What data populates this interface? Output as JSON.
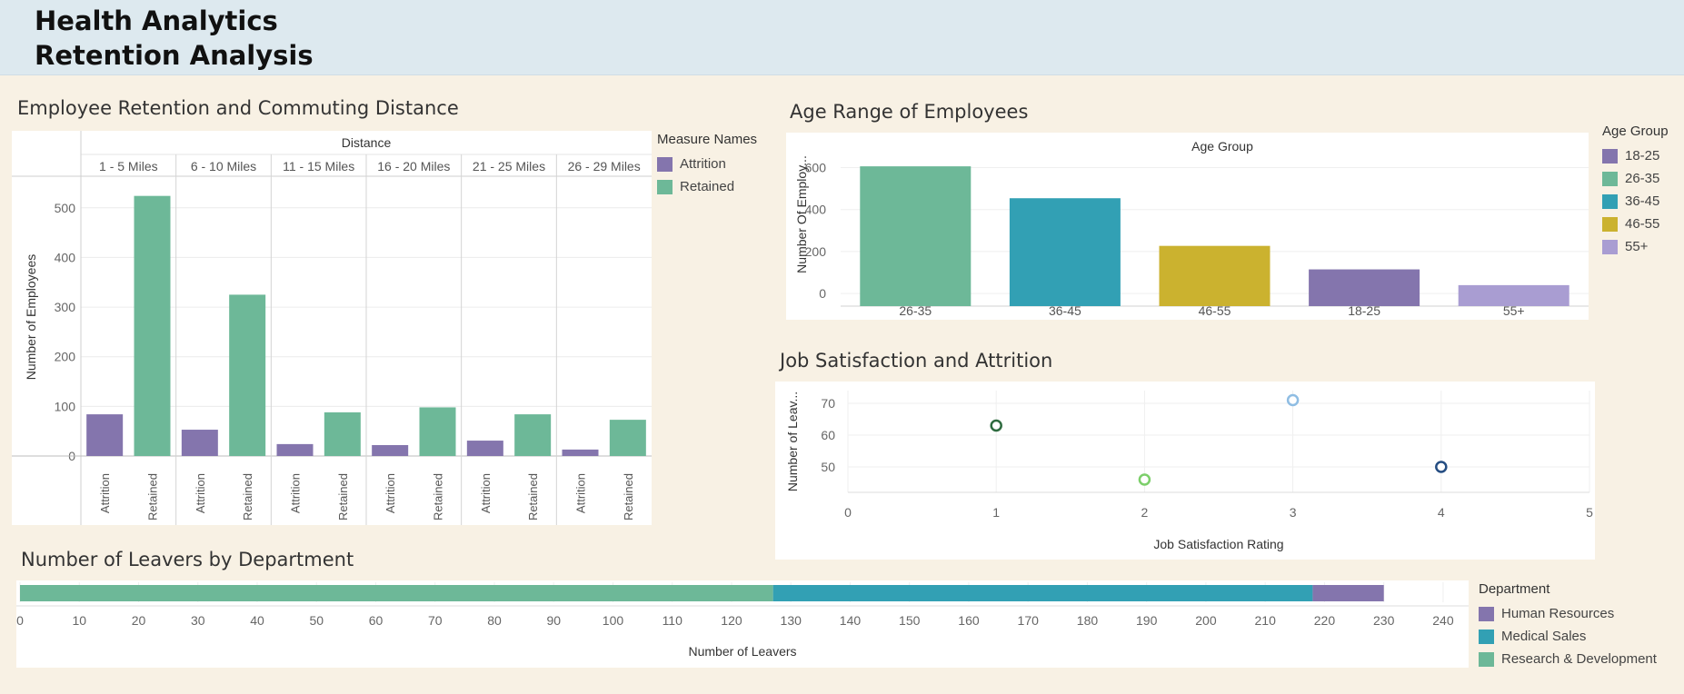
{
  "header": {
    "title_line1": "Health Analytics",
    "title_line2": "Retention Analysis"
  },
  "commute": {
    "title": "Employee Retention and Commuting Distance",
    "legend_title": "Measure Names",
    "legend": [
      {
        "label": "Attrition",
        "color": "#8475ad"
      },
      {
        "label": "Retained",
        "color": "#6db898"
      }
    ]
  },
  "age": {
    "title": "Age Range of Employees",
    "legend_title": "Age Group",
    "legend": [
      {
        "label": "18-25",
        "color": "#8475ad"
      },
      {
        "label": "26-35",
        "color": "#6db898"
      },
      {
        "label": "36-45",
        "color": "#32a0b4"
      },
      {
        "label": "46-55",
        "color": "#cbb22f"
      },
      {
        "label": "55+",
        "color": "#a99dd2"
      }
    ]
  },
  "satisfaction": {
    "title": "Job Satisfaction and Attrition"
  },
  "leavers": {
    "title": "Number of Leavers by Department",
    "legend_title": "Department",
    "legend": [
      {
        "label": "Human Resources",
        "color": "#8475ad"
      },
      {
        "label": "Medical Sales",
        "color": "#32a0b4"
      },
      {
        "label": "Research & Development",
        "color": "#6db898"
      }
    ]
  },
  "chart_data": [
    {
      "type": "bar",
      "title": "Employee Retention and Commuting Distance",
      "header_label": "Distance",
      "ylabel": "Number of Employees",
      "categories": [
        "1 - 5 Miles",
        "6 - 10 Miles",
        "11 - 15 Miles",
        "16 - 20 Miles",
        "21 - 25 Miles",
        "26 - 29 Miles"
      ],
      "measures": [
        "Attrition",
        "Retained"
      ],
      "series": [
        {
          "name": "Attrition",
          "color": "#8475ad",
          "values": [
            84,
            53,
            24,
            22,
            31,
            13
          ]
        },
        {
          "name": "Retained",
          "color": "#6db898",
          "values": [
            524,
            325,
            88,
            98,
            84,
            73
          ]
        }
      ],
      "ylim": [
        0,
        560
      ],
      "yticks": [
        0,
        100,
        200,
        300,
        400,
        500
      ],
      "legend_position": "right",
      "grid": true
    },
    {
      "type": "bar",
      "title": "Age Range of Employees",
      "header_label": "Age Group",
      "ylabel": "Number Of Employ...",
      "categories": [
        "26-35",
        "36-45",
        "46-55",
        "18-25",
        "55+"
      ],
      "values": [
        606,
        454,
        227,
        115,
        40
      ],
      "colors": [
        "#6db898",
        "#32a0b4",
        "#cbb22f",
        "#8475ad",
        "#a99dd2"
      ],
      "ylim": [
        -60,
        680
      ],
      "yticks": [
        0,
        200,
        400,
        600
      ],
      "legend_position": "right",
      "grid": true
    },
    {
      "type": "scatter",
      "title": "Job Satisfaction and Attrition",
      "xlabel": "Job Satisfaction Rating",
      "ylabel": "Number of Leav...",
      "points": [
        {
          "x": 1,
          "y": 63,
          "color": "#2e6b3f"
        },
        {
          "x": 2,
          "y": 46,
          "color": "#7ccf6a"
        },
        {
          "x": 3,
          "y": 71,
          "color": "#8fbde3"
        },
        {
          "x": 4,
          "y": 50,
          "color": "#254d82"
        }
      ],
      "xlim": [
        0,
        5
      ],
      "ylim": [
        42,
        74
      ],
      "xticks": [
        0,
        1,
        2,
        3,
        4,
        5
      ],
      "yticks": [
        50,
        60,
        70
      ],
      "grid": true
    },
    {
      "type": "bar",
      "orientation": "horizontal-stacked",
      "title": "Number of Leavers by Department",
      "xlabel": "Number of Leavers",
      "series": [
        {
          "name": "Research & Development",
          "color": "#6db898",
          "value": 127
        },
        {
          "name": "Medical Sales",
          "color": "#32a0b4",
          "value": 91
        },
        {
          "name": "Human Resources",
          "color": "#8475ad",
          "value": 12
        }
      ],
      "xlim": [
        0,
        242
      ],
      "xticks": [
        0,
        10,
        20,
        30,
        40,
        50,
        60,
        70,
        80,
        90,
        100,
        110,
        120,
        130,
        140,
        150,
        160,
        170,
        180,
        190,
        200,
        210,
        220,
        230,
        240
      ],
      "legend_position": "right",
      "grid": true
    }
  ]
}
